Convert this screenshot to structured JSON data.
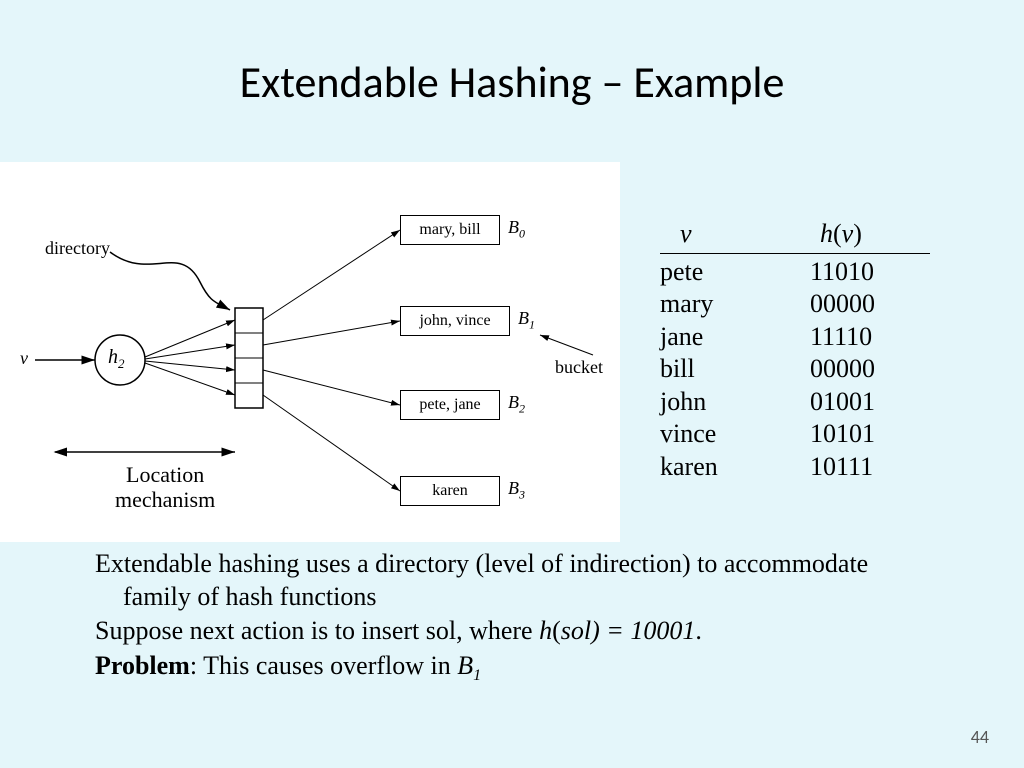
{
  "title": "Extendable Hashing – Example",
  "pageNumber": "44",
  "diagram": {
    "vLabel": "v",
    "hashNode": "h",
    "hashSub": "2",
    "directoryLabel": "directory",
    "bucketLabel": "bucket",
    "locationMechanism1": "Location",
    "locationMechanism2": "mechanism",
    "buckets": [
      {
        "content": "mary, bill",
        "label": "B",
        "sub": "0"
      },
      {
        "content": "john, vince",
        "label": "B",
        "sub": "1"
      },
      {
        "content": "pete, jane",
        "label": "B",
        "sub": "2"
      },
      {
        "content": "karen",
        "label": "B",
        "sub": "3"
      }
    ]
  },
  "hashTable": {
    "headerV": "v",
    "headerH_h": "h",
    "headerH_open": "(",
    "headerH_v": "v",
    "headerH_close": ")",
    "rows": [
      {
        "v": "pete",
        "h": "11010"
      },
      {
        "v": "mary",
        "h": "00000"
      },
      {
        "v": "jane",
        "h": "11110"
      },
      {
        "v": "bill",
        "h": "00000"
      },
      {
        "v": "john",
        "h": "01001"
      },
      {
        "v": "vince",
        "h": "10101"
      },
      {
        "v": "karen",
        "h": "10111"
      }
    ]
  },
  "body": {
    "line1": "Extendable hashing uses a directory  (level of indirection) to accommodate family of hash functions",
    "line2a": "Suppose next action is to insert sol, where ",
    "line2_h": "h",
    "line2_open": "(",
    "line2_sol": "sol",
    "line2_close": ") = 10001",
    "line2_period": ".",
    "line3_problem": "Problem",
    "line3_rest": ":  This causes overflow in ",
    "line3_B": "B",
    "line3_sub": "1"
  }
}
